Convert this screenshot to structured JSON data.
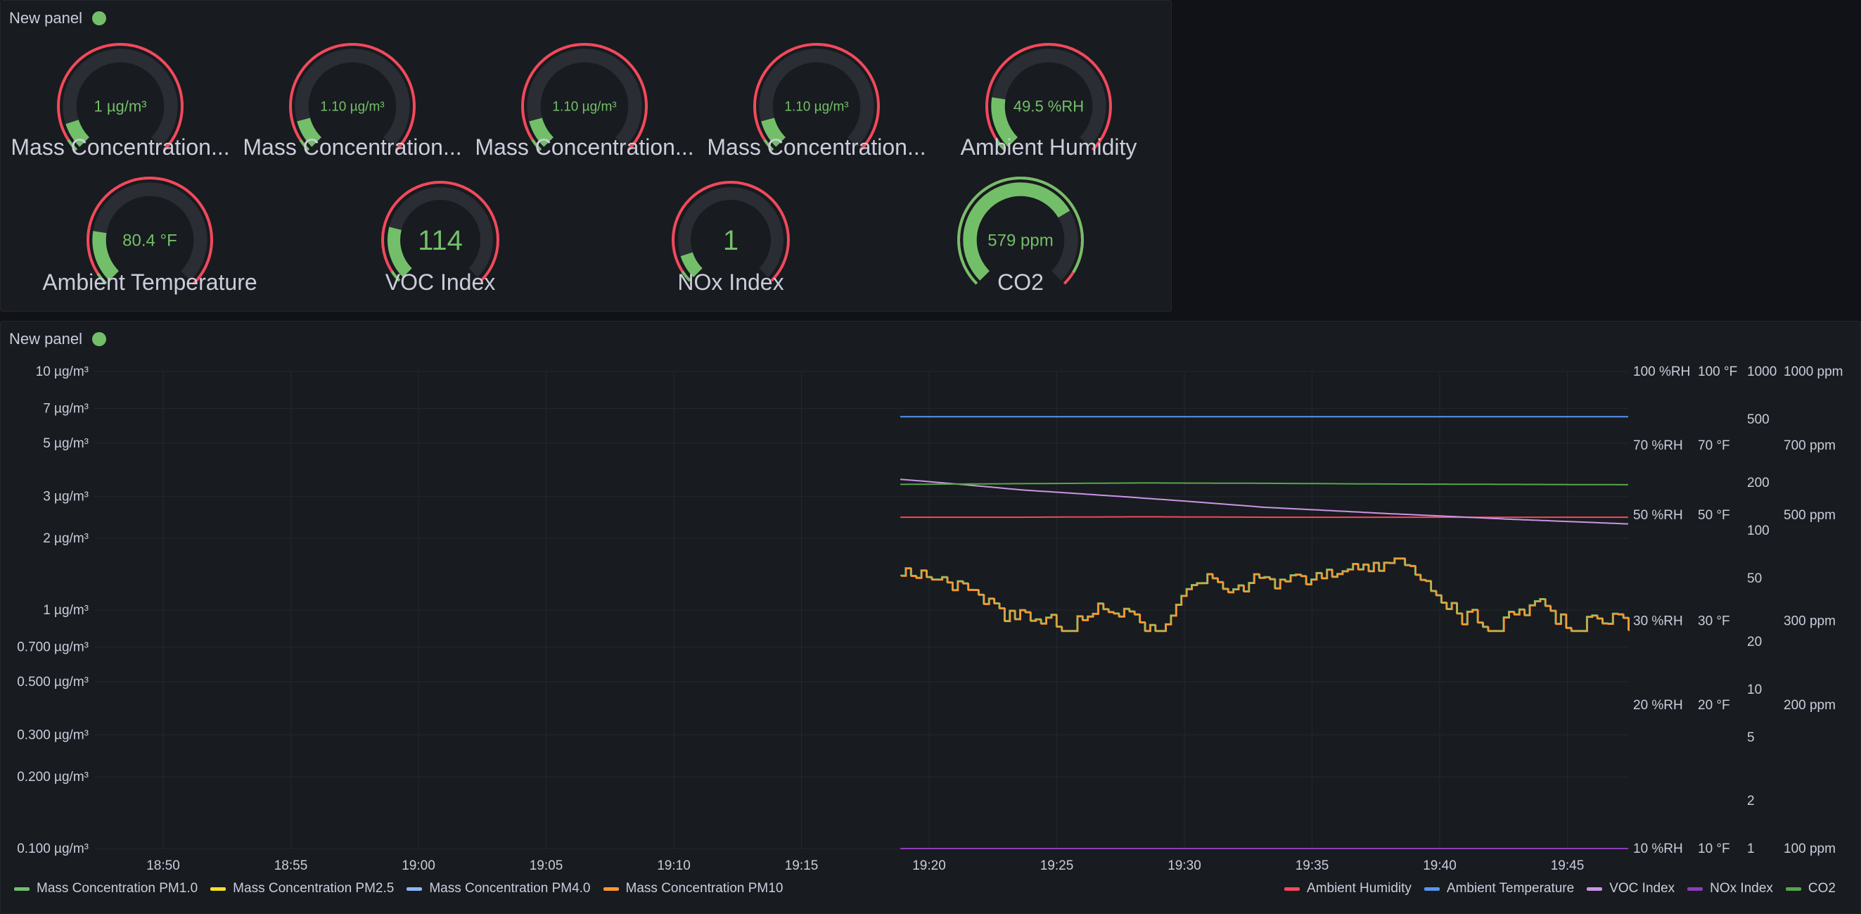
{
  "colors": {
    "green": "#73bf69",
    "red": "#f2495c",
    "blue": "#5794f2",
    "violet": "#ca95e5",
    "purple": "#8f3bb8",
    "orange": "#ff9830",
    "yellow": "#fade2a",
    "lightblue": "#8ab8ff"
  },
  "top_panel": {
    "title": "New panel",
    "gauges_row1": [
      {
        "title": "Mass Concentration...",
        "value": "1 µg/m³",
        "fraction": 0.1
      },
      {
        "title": "Mass Concentration...",
        "value": "1.10 µg/m³",
        "fraction": 0.11
      },
      {
        "title": "Mass Concentration...",
        "value": "1.10 µg/m³",
        "fraction": 0.11
      },
      {
        "title": "Mass Concentration...",
        "value": "1.10 µg/m³",
        "fraction": 0.11
      },
      {
        "title": "Ambient Humidity",
        "value": "49.5 %RH",
        "fraction": 0.2
      }
    ],
    "gauges_row2": [
      {
        "title": "Ambient Temperature",
        "value": "80.4 °F",
        "fraction": 0.2
      },
      {
        "title": "VOC Index",
        "value": "114",
        "fraction": 0.22
      },
      {
        "title": "NOx Index",
        "value": "1",
        "fraction": 0.1
      },
      {
        "title": "CO2",
        "value": "579 ppm",
        "fraction": 0.72
      }
    ]
  },
  "bottom_panel": {
    "title": "New panel",
    "legend_left": [
      {
        "label": "Mass Concentration PM1.0",
        "color": "#73bf69"
      },
      {
        "label": "Mass Concentration PM2.5",
        "color": "#fade2a"
      },
      {
        "label": "Mass Concentration PM4.0",
        "color": "#8ab8ff"
      },
      {
        "label": "Mass Concentration PM10",
        "color": "#ff9830"
      }
    ],
    "legend_right": [
      {
        "label": "Ambient Humidity",
        "color": "#f2495c"
      },
      {
        "label": "Ambient Temperature",
        "color": "#5794f2"
      },
      {
        "label": "VOC Index",
        "color": "#ca95e5"
      },
      {
        "label": "NOx Index",
        "color": "#8f3bb8"
      },
      {
        "label": "CO2",
        "color": "#56a64b"
      }
    ]
  },
  "chart_data": {
    "type": "line",
    "x_ticks": [
      "18:50",
      "18:55",
      "19:00",
      "19:05",
      "19:10",
      "19:15",
      "19:20",
      "19:25",
      "19:30",
      "19:35",
      "19:40",
      "19:45"
    ],
    "y_left_ticks": [
      "10 µg/m³",
      "7 µg/m³",
      "5 µg/m³",
      "3 µg/m³",
      "2 µg/m³",
      "1 µg/m³",
      "0.700 µg/m³",
      "0.500 µg/m³",
      "0.300 µg/m³",
      "0.200 µg/m³",
      "0.100 µg/m³"
    ],
    "y_left_values": [
      10,
      7,
      5,
      3,
      2,
      1,
      0.7,
      0.5,
      0.3,
      0.2,
      0.1
    ],
    "y_rh_ticks": [
      "100 %RH",
      "70 %RH",
      "50 %RH",
      "30 %RH",
      "20 %RH",
      "10 %RH"
    ],
    "y_rh_values": [
      100,
      70,
      50,
      30,
      20,
      10
    ],
    "y_f_ticks": [
      "100 °F",
      "70 °F",
      "50 °F",
      "30 °F",
      "20 °F",
      "10 °F"
    ],
    "y_f_values": [
      100,
      70,
      50,
      30,
      20,
      10
    ],
    "y_idx_ticks": [
      "1000",
      "500",
      "200",
      "100",
      "50",
      "20",
      "10",
      "5",
      "2",
      "1"
    ],
    "y_idx_values": [
      1000,
      500,
      200,
      100,
      50,
      20,
      10,
      5,
      2,
      1
    ],
    "y_ppm_ticks": [
      "1000 ppm",
      "700 ppm",
      "500 ppm",
      "300 ppm",
      "200 ppm",
      "100 ppm"
    ],
    "y_ppm_values": [
      1000,
      700,
      500,
      300,
      200,
      100
    ],
    "series": [
      {
        "name": "Ambient Humidity",
        "axis": "rh",
        "values": [
          49.5,
          49.5,
          49.6,
          49.5,
          49.5,
          49.5,
          49.5
        ]
      },
      {
        "name": "Ambient Temperature",
        "axis": "f",
        "values": [
          80.4,
          80.4,
          80.4,
          80.4,
          80.4,
          80.4,
          80.4
        ]
      },
      {
        "name": "VOC Index",
        "axis": "idx",
        "values": [
          210,
          180,
          160,
          140,
          128,
          118,
          110
        ]
      },
      {
        "name": "NOx Index",
        "axis": "idx",
        "values": [
          1,
          1,
          1,
          1,
          1,
          1,
          1
        ]
      },
      {
        "name": "CO2",
        "axis": "ppm",
        "values": [
          580,
          582,
          584,
          583,
          581,
          580,
          579
        ]
      }
    ]
  }
}
